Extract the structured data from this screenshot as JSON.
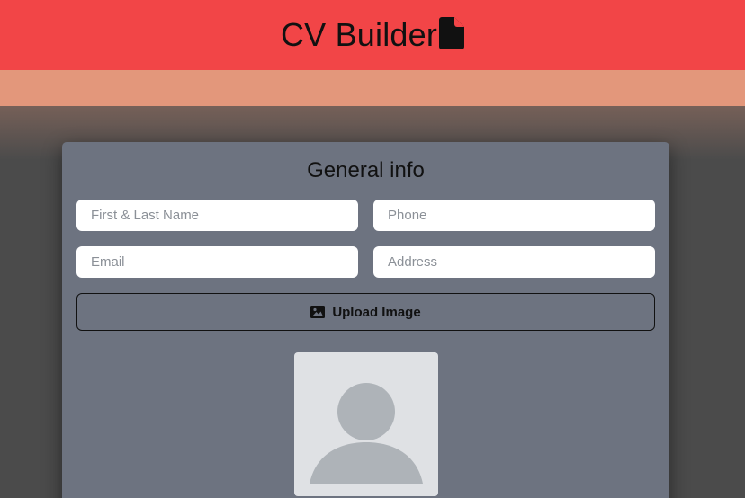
{
  "header": {
    "title": "CV Builder",
    "icon": "file-icon",
    "background": "#f24547"
  },
  "general_info": {
    "heading": "General info",
    "fields": {
      "name_placeholder": "First & Last Name",
      "phone_placeholder": "Phone",
      "email_placeholder": "Email",
      "address_placeholder": "Address"
    },
    "upload_button": {
      "label": "Upload Image",
      "icon": "image-icon"
    },
    "avatar": {
      "icon": "user-placeholder-icon"
    }
  },
  "colors": {
    "header": "#f24547",
    "band": "#e3977b",
    "page_background": "#4b4b4b",
    "card": "#6d7380"
  }
}
